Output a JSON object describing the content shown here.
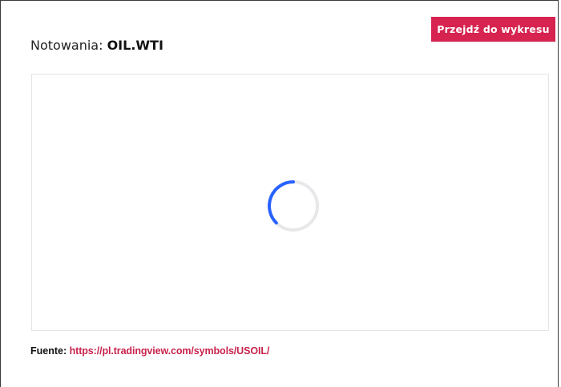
{
  "header": {
    "title_prefix": "Notowania: ",
    "symbol": "OIL.WTI",
    "chart_button_label": "Przejdź do wykresu"
  },
  "chart": {
    "state": "loading",
    "spinner_icon": "loading-spinner-icon",
    "spinner_color": "#2962ff",
    "spinner_track_color": "#e8e8ea"
  },
  "footer": {
    "source_label": "Fuente: ",
    "source_url": "https://pl.tradingview.com/symbols/USOIL/"
  },
  "colors": {
    "accent": "#d6234f",
    "link": "#c8234c",
    "frame_border": "#3a3a3a",
    "panel_border": "#e4e4e4"
  }
}
